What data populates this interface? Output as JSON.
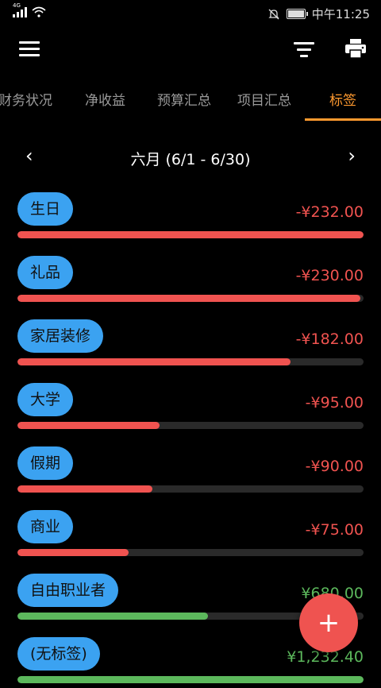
{
  "status": {
    "network": "4G",
    "time": "中午11:25"
  },
  "toolbar": {
    "menu_icon": "menu-icon",
    "filter_icon": "filter-icon",
    "print_icon": "print-icon"
  },
  "tabs": [
    {
      "label": "财务状况"
    },
    {
      "label": "净收益"
    },
    {
      "label": "预算汇总"
    },
    {
      "label": "项目汇总"
    },
    {
      "label": "标签",
      "active": true
    }
  ],
  "period": {
    "label": "六月 (6/1 - 6/30)",
    "prev": "‹",
    "next": "›"
  },
  "tag_rows": [
    {
      "tag": "生日",
      "amount": "-¥232.00",
      "kind": "neg",
      "share": 1.0
    },
    {
      "tag": "礼品",
      "amount": "-¥230.00",
      "kind": "neg",
      "share": 0.99
    },
    {
      "tag": "家居装修",
      "amount": "-¥182.00",
      "kind": "neg",
      "share": 0.79
    },
    {
      "tag": "大学",
      "amount": "-¥95.00",
      "kind": "neg",
      "share": 0.41
    },
    {
      "tag": "假期",
      "amount": "-¥90.00",
      "kind": "neg",
      "share": 0.39
    },
    {
      "tag": "商业",
      "amount": "-¥75.00",
      "kind": "neg",
      "share": 0.32
    },
    {
      "tag": "自由职业者",
      "amount": "¥680.00",
      "kind": "pos",
      "share": 0.55
    },
    {
      "tag": "(无标签)",
      "amount": "¥1,232.40",
      "kind": "pos",
      "share": 1.0
    }
  ],
  "colors": {
    "negative": "#f05350",
    "positive": "#5cb85c",
    "chip": "#3ba2f1",
    "accent": "#ff9a2f"
  },
  "fab": {
    "label": "+"
  }
}
